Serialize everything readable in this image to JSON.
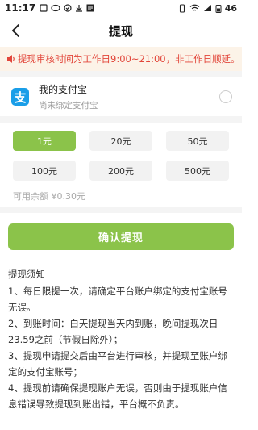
{
  "status_bar": {
    "time": "11:17",
    "left_icons": [
      "sim-icon",
      "message-icon",
      "check-icon",
      "download-icon",
      "news-icon"
    ],
    "battery": "46"
  },
  "nav": {
    "title": "提现"
  },
  "notice": {
    "text": "提现审核时间为工作日9:00~21:00，非工作日顺延。",
    "color": "#e2463a"
  },
  "payment": {
    "name": "我的支付宝",
    "status": "尚未绑定支付宝",
    "logo_glyph": "支"
  },
  "amounts": {
    "options": [
      "1元",
      "20元",
      "50元",
      "100元",
      "200元",
      "500元"
    ],
    "selected": "1元"
  },
  "balance": {
    "label": "可用余额",
    "value": "¥0.30元"
  },
  "confirm_label": "确认提现",
  "rules": {
    "title": "提现须知",
    "items": [
      "1、每日限提一次，请确定平台账户绑定的支付宝账号无误。",
      "2、到账时间：白天提现当天内到账，晚间提现次日23.59之前（节假日除外）；",
      "3、提现申请提交后由平台进行审核，并提现至账户绑定的支付宝账号；",
      "4、提现前请确保提现账户无误，否则由于提现账户信息错误导致提现到账出错，平台概不负责。"
    ]
  },
  "colors": {
    "accent": "#8bc34a",
    "notice_bg": "#fcf3e8",
    "alipay": "#1a9ee8"
  }
}
